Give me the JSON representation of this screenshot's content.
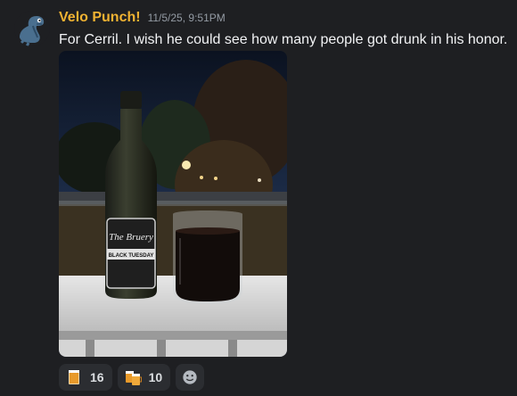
{
  "message": {
    "author": "Velo Punch!",
    "timestamp": "11/5/25, 9:51PM",
    "text": "For Cerril. I wish he could see how many people got drunk in his honor.",
    "attachment": {
      "bottle_label": {
        "brand": "The Bruery",
        "name": "BLACK TUESDAY"
      }
    },
    "reactions": [
      {
        "icon": "beer-glass-icon",
        "count": "16"
      },
      {
        "icon": "beer-mugs-icon",
        "count": "10"
      }
    ],
    "add_reaction_icon": "smiley-add-icon"
  },
  "colors": {
    "background": "#1e1f22",
    "username": "#f0b232",
    "timestamp": "#949ba4",
    "text": "#f2f3f5",
    "reaction_bg": "#2b2d31"
  }
}
